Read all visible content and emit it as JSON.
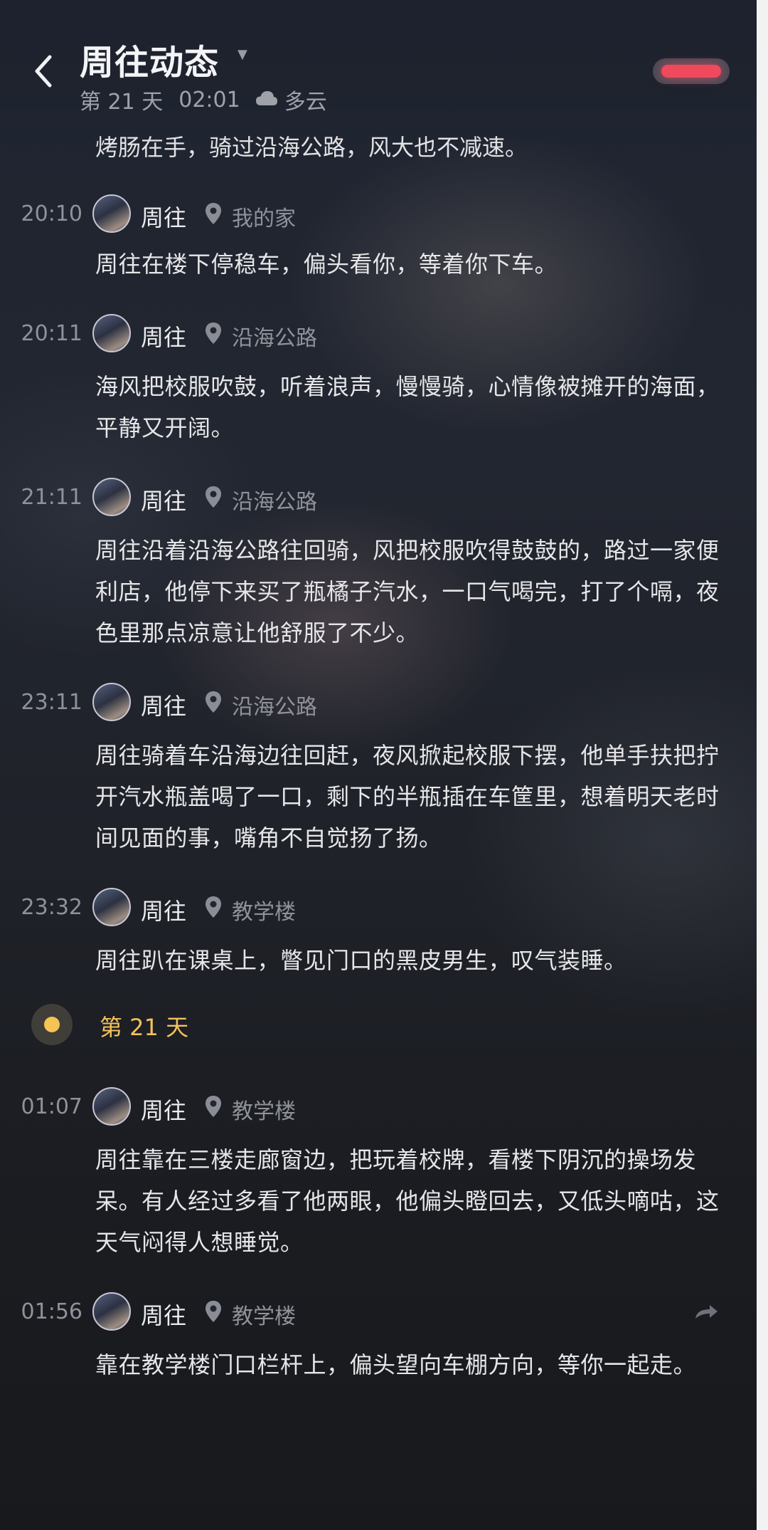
{
  "header": {
    "title": "周往动态",
    "day": "第 21 天",
    "time": "02:01",
    "weather": "多云"
  },
  "cut_text": "烤肠在手，骑过沿海公路，风大也不减速。",
  "entries": [
    {
      "time": "20:10",
      "name": "周往",
      "location": "我的家",
      "text": "周往在楼下停稳车，偏头看你，等着你下车。"
    },
    {
      "time": "20:11",
      "name": "周往",
      "location": "沿海公路",
      "text": "海风把校服吹鼓，听着浪声，慢慢骑，心情像被摊开的海面，平静又开阔。"
    },
    {
      "time": "21:11",
      "name": "周往",
      "location": "沿海公路",
      "text": "周往沿着沿海公路往回骑，风把校服吹得鼓鼓的，路过一家便利店，他停下来买了瓶橘子汽水，一口气喝完，打了个嗝，夜色里那点凉意让他舒服了不少。"
    },
    {
      "time": "23:11",
      "name": "周往",
      "location": "沿海公路",
      "text": "周往骑着车沿海边往回赶，夜风掀起校服下摆，他单手扶把拧开汽水瓶盖喝了一口，剩下的半瓶插在车筐里，想着明天老时间见面的事，嘴角不自觉扬了扬。"
    },
    {
      "time": "23:32",
      "name": "周往",
      "location": "教学楼",
      "text": "周往趴在课桌上，瞥见门口的黑皮男生，叹气装睡。"
    }
  ],
  "day_divider": "第 21 天",
  "entries2": [
    {
      "time": "01:07",
      "name": "周往",
      "location": "教学楼",
      "text": "周往靠在三楼走廊窗边，把玩着校牌，看楼下阴沉的操场发呆。有人经过多看了他两眼，他偏头瞪回去，又低头嘀咕，这天气闷得人想睡觉。"
    },
    {
      "time": "01:56",
      "name": "周往",
      "location": "教学楼",
      "text": "靠在教学楼门口栏杆上，偏头望向车棚方向，等你一起走。"
    }
  ],
  "icons": [
    "back-arrow-icon",
    "dropdown-caret-icon",
    "cloud-icon",
    "location-pin-icon",
    "share-icon",
    "avatar"
  ],
  "colors": {
    "accent_day": "#f4c15a",
    "toggle_red": "#f0495e"
  }
}
